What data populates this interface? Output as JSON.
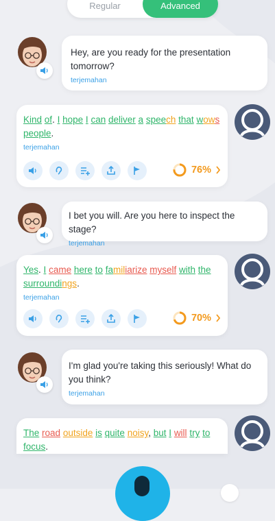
{
  "toggle": {
    "left_label": "Regular",
    "right_label": "Advanced"
  },
  "messages": [
    {
      "role": "bot",
      "text": "Hey, are you ready for the presentation tomorrow?",
      "translate": "terjemahan"
    },
    {
      "role": "user",
      "words": [
        {
          "t": "Kind",
          "c": "g"
        },
        {
          "t": " ",
          "c": "k"
        },
        {
          "t": "of",
          "c": "g"
        },
        {
          "t": ". ",
          "c": "k"
        },
        {
          "t": "I",
          "c": "g"
        },
        {
          "t": " ",
          "c": "k"
        },
        {
          "t": "hope",
          "c": "g"
        },
        {
          "t": " ",
          "c": "k"
        },
        {
          "t": "I",
          "c": "g"
        },
        {
          "t": " ",
          "c": "k"
        },
        {
          "t": "can",
          "c": "g"
        },
        {
          "t": " ",
          "c": "k"
        },
        {
          "t": "deliver",
          "c": "g"
        },
        {
          "t": " ",
          "c": "k"
        },
        {
          "t": "a",
          "c": "g"
        },
        {
          "t": " ",
          "c": "k"
        },
        {
          "t": "spee",
          "c": "g"
        },
        {
          "t": "ch",
          "c": "o"
        },
        {
          "t": " ",
          "c": "k"
        },
        {
          "t": "that",
          "c": "g"
        },
        {
          "t": " ",
          "c": "k"
        },
        {
          "t": "w",
          "c": "g"
        },
        {
          "t": "ow",
          "c": "o"
        },
        {
          "t": "s",
          "c": "r"
        },
        {
          "t": " ",
          "c": "k"
        },
        {
          "t": "people",
          "c": "g"
        },
        {
          "t": ".",
          "c": "k"
        }
      ],
      "translate": "terjemahan",
      "score": "76%",
      "score_fraction": 0.76
    },
    {
      "role": "bot",
      "text": "I bet you will. Are you here to inspect the stage?",
      "translate": "terjemahan"
    },
    {
      "role": "user",
      "words": [
        {
          "t": "Yes",
          "c": "g"
        },
        {
          "t": ". ",
          "c": "k"
        },
        {
          "t": "I",
          "c": "g"
        },
        {
          "t": " ",
          "c": "k"
        },
        {
          "t": "came",
          "c": "r"
        },
        {
          "t": " ",
          "c": "k"
        },
        {
          "t": "here",
          "c": "g"
        },
        {
          "t": " ",
          "c": "k"
        },
        {
          "t": "to",
          "c": "g"
        },
        {
          "t": " ",
          "c": "k"
        },
        {
          "t": "fa",
          "c": "g"
        },
        {
          "t": "mil",
          "c": "o"
        },
        {
          "t": "iarize",
          "c": "r"
        },
        {
          "t": " ",
          "c": "k"
        },
        {
          "t": "myself",
          "c": "r"
        },
        {
          "t": " ",
          "c": "k"
        },
        {
          "t": "with",
          "c": "g"
        },
        {
          "t": " ",
          "c": "k"
        },
        {
          "t": "the",
          "c": "g"
        },
        {
          "t": " ",
          "c": "k"
        },
        {
          "t": "surroundi",
          "c": "g"
        },
        {
          "t": "ngs",
          "c": "o"
        },
        {
          "t": ".",
          "c": "k"
        }
      ],
      "translate": "terjemahan",
      "score": "70%",
      "score_fraction": 0.7
    },
    {
      "role": "bot",
      "text": "I'm glad you're taking this seriously! What do you think?",
      "translate": "terjemahan"
    },
    {
      "role": "user",
      "words": [
        {
          "t": "The",
          "c": "g"
        },
        {
          "t": " ",
          "c": "k"
        },
        {
          "t": "road",
          "c": "r"
        },
        {
          "t": " ",
          "c": "k"
        },
        {
          "t": "outside",
          "c": "o"
        },
        {
          "t": " ",
          "c": "k"
        },
        {
          "t": "is",
          "c": "g"
        },
        {
          "t": " ",
          "c": "k"
        },
        {
          "t": "quite",
          "c": "g"
        },
        {
          "t": " ",
          "c": "k"
        },
        {
          "t": "noisy",
          "c": "o"
        },
        {
          "t": ", ",
          "c": "k"
        },
        {
          "t": "but",
          "c": "g"
        },
        {
          "t": " ",
          "c": "k"
        },
        {
          "t": "I",
          "c": "g"
        },
        {
          "t": " ",
          "c": "k"
        },
        {
          "t": "will",
          "c": "r"
        },
        {
          "t": " ",
          "c": "k"
        },
        {
          "t": "try",
          "c": "g"
        },
        {
          "t": " ",
          "c": "k"
        },
        {
          "t": "to",
          "c": "g"
        },
        {
          "t": " ",
          "c": "k"
        },
        {
          "t": "focus",
          "c": "g"
        },
        {
          "t": ".",
          "c": "k"
        }
      ]
    }
  ],
  "icons": {
    "actions": [
      "speaker-icon",
      "ear-icon",
      "add-to-list-icon",
      "share-icon",
      "flag-icon"
    ],
    "score_ring": "progress-ring-icon",
    "chevron": "chevron-right-icon",
    "fab": "microphone-icon"
  },
  "colors": {
    "green": "#2fb56a",
    "orange": "#f0a31e",
    "red": "#e85a4f",
    "link": "#3aa0e6",
    "accent": "#35c07a",
    "fab": "#1fb3e8",
    "avatar_user": "#4a5a78"
  }
}
